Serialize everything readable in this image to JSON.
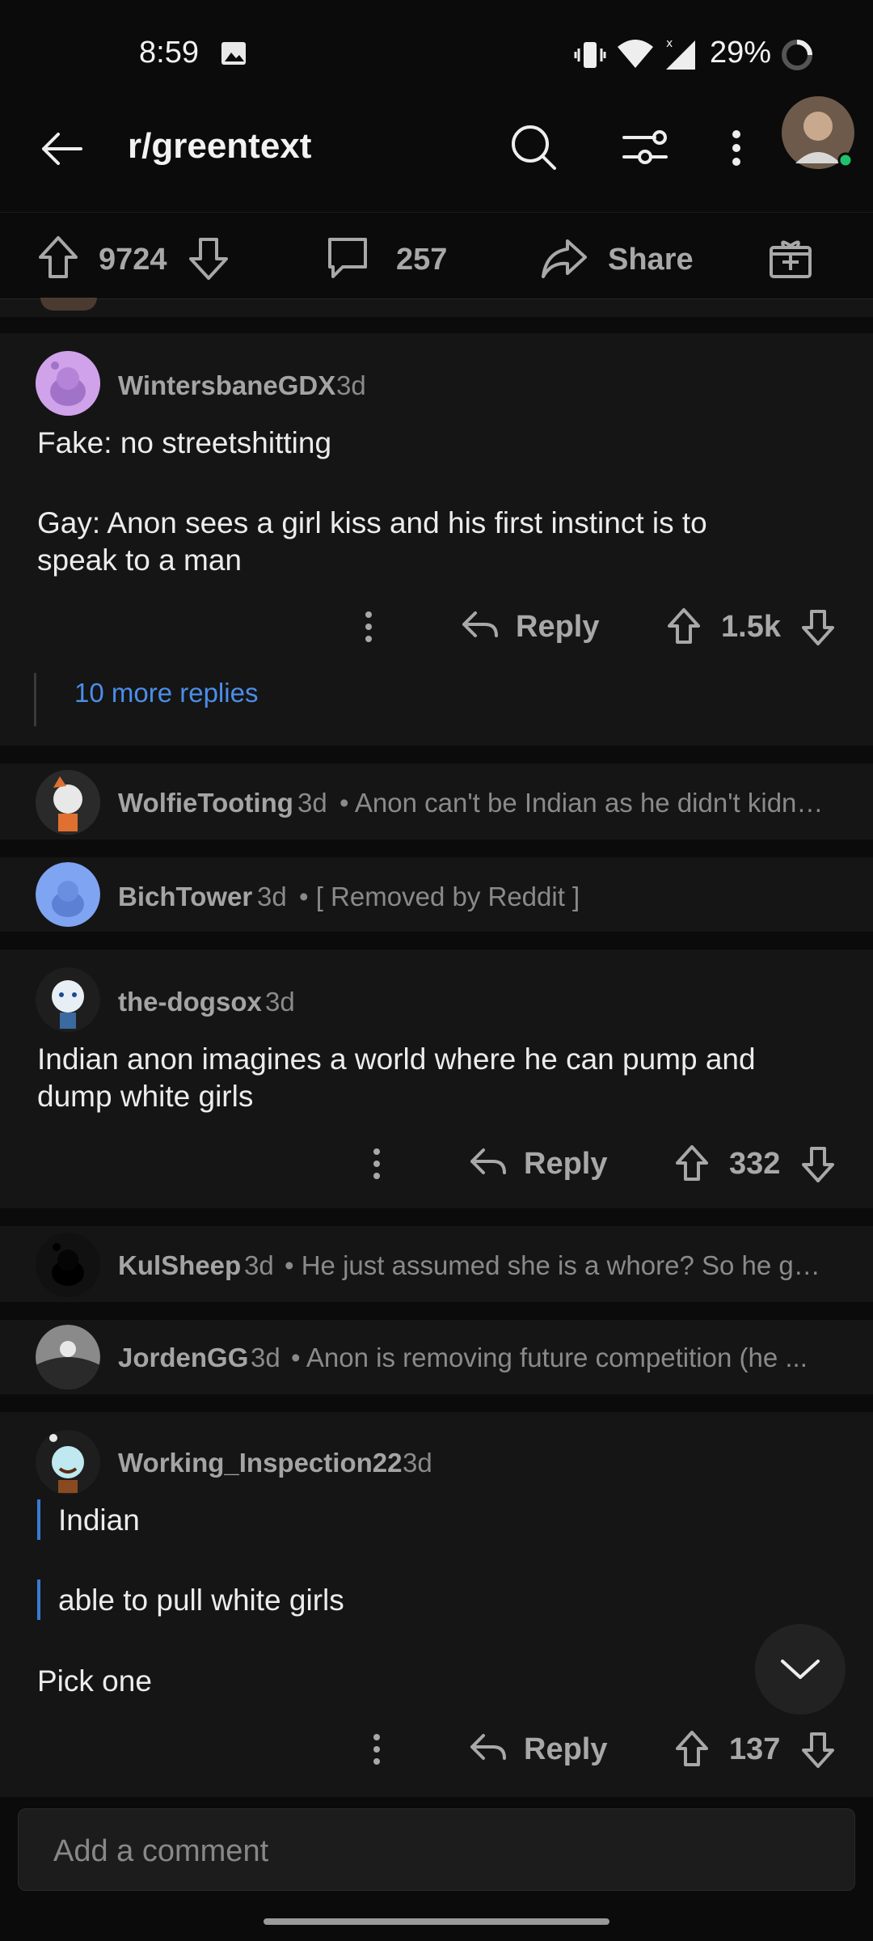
{
  "status_bar": {
    "time": "8:59",
    "battery": "29%"
  },
  "header": {
    "title": "r/greentext"
  },
  "post_actions": {
    "score": "9724",
    "comments": "257",
    "share_label": "Share"
  },
  "comments": [
    {
      "user": "WintersbaneGDX",
      "age": "3d",
      "lines": [
        "Fake:  no streetshitting",
        "Gay:  Anon sees a girl kiss and his first instinct is to",
        "speak to a man"
      ],
      "reply_label": "Reply",
      "score": "1.5k",
      "more_replies": "10 more replies"
    },
    {
      "user": "WolfieTooting",
      "age": "3d",
      "snippet": "• Anon can't be Indian as he didn't kidnap her and ..."
    },
    {
      "user": "BichTower",
      "age": "3d",
      "snippet": "• [ Removed by Reddit ]"
    },
    {
      "user": "the-dogsox",
      "age": "3d",
      "lines": [
        "Indian anon imagines a world where he can pump and",
        "dump white girls"
      ],
      "reply_label": "Reply",
      "score": "332"
    },
    {
      "user": "KulSheep",
      "age": "3d",
      "snippet": "• He just assumed she is a whore? So he goes and ..."
    },
    {
      "user": "JordenGG",
      "age": "3d",
      "snippet": "• Anon is removing future competition (he ..."
    },
    {
      "user": "Working_Inspection22",
      "age": "3d",
      "quote1": "Indian",
      "quote2": "able to pull white girls",
      "line": "Pick one",
      "reply_label": "Reply",
      "score": "137"
    }
  ],
  "composer": {
    "placeholder": "Add a comment"
  }
}
